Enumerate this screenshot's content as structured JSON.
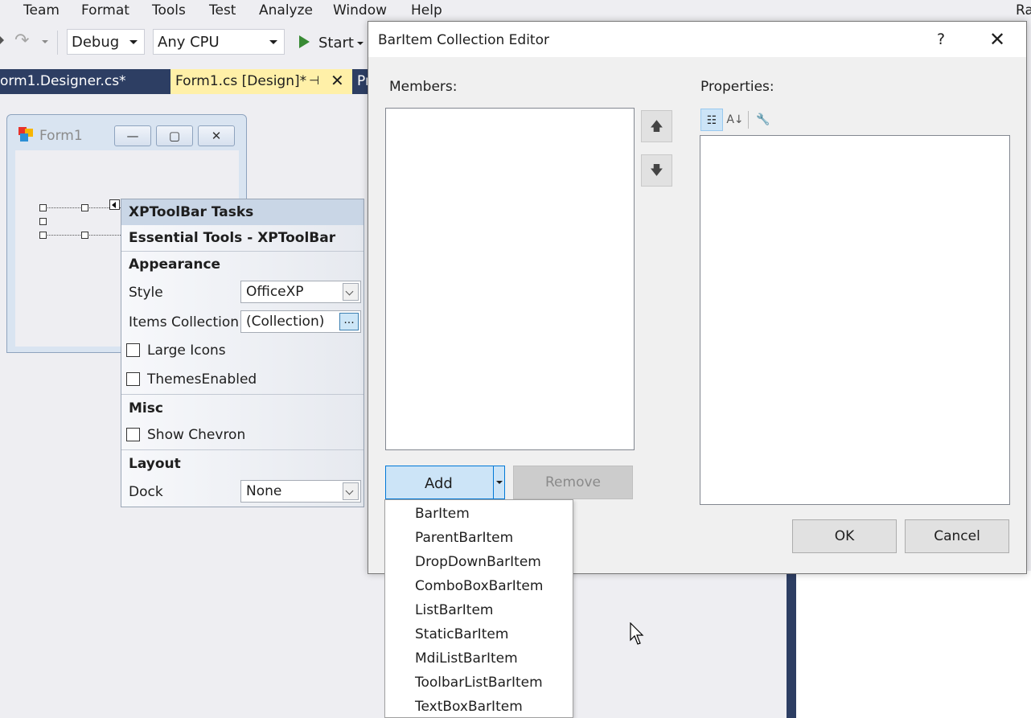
{
  "menubar": {
    "items": [
      "Team",
      "Format",
      "Tools",
      "Test",
      "Analyze",
      "Window",
      "Help"
    ],
    "account": "Ra"
  },
  "toolbar": {
    "config": "Debug",
    "platform": "Any CPU",
    "start_label": "Start"
  },
  "doc_tabs": {
    "designer_cs": "orm1.Designer.cs*",
    "form1_design": "Form1.cs [Design]*",
    "partial": "Pr"
  },
  "form1": {
    "title": "Form1",
    "min": "—",
    "max": "▢",
    "close": "✕"
  },
  "tasks_panel": {
    "header": "XPToolBar Tasks",
    "subheader": "Essential Tools - XPToolBar",
    "appearance_section": "Appearance",
    "style_label": "Style",
    "style_value": "OfficeXP",
    "items_label": "Items Collection",
    "items_value": "(Collection)",
    "ellipsis": "...",
    "large_icons": "Large Icons",
    "themes_enabled": "ThemesEnabled",
    "misc_section": "Misc",
    "show_chevron": "Show Chevron",
    "layout_section": "Layout",
    "dock_label": "Dock",
    "dock_value": "None"
  },
  "dialog": {
    "title": "BarItem Collection Editor",
    "help": "?",
    "close": "✕",
    "members_label": "Members:",
    "properties_label": "Properties:",
    "add_label": "Add",
    "remove_label": "Remove",
    "ok_label": "OK",
    "cancel_label": "Cancel"
  },
  "add_menu": {
    "items": [
      "BarItem",
      "ParentBarItem",
      "DropDownBarItem",
      "ComboBoxBarItem",
      "ListBarItem",
      "StaticBarItem",
      "MdiListBarItem",
      "ToolbarListBarItem",
      "TextBoxBarItem"
    ]
  },
  "colors": {
    "accent": "#0078d7",
    "vs_dark": "#2d3e63",
    "active_tab": "#fff0a8",
    "start_green": "#388a34"
  }
}
